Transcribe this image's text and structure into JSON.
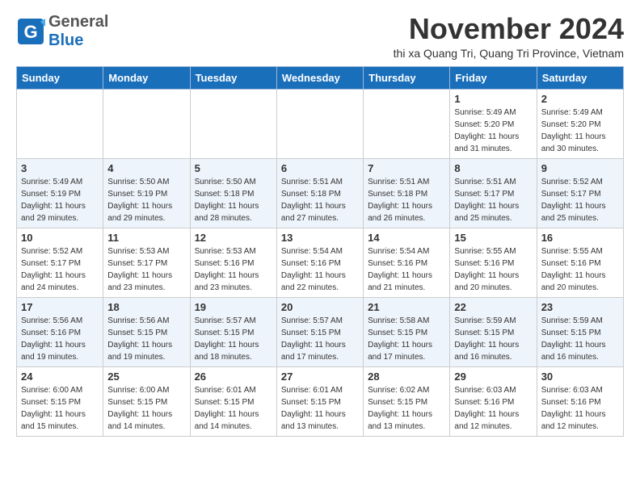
{
  "header": {
    "logo_general": "General",
    "logo_blue": "Blue",
    "month_title": "November 2024",
    "subtitle": "thi xa Quang Tri, Quang Tri Province, Vietnam"
  },
  "days_of_week": [
    "Sunday",
    "Monday",
    "Tuesday",
    "Wednesday",
    "Thursday",
    "Friday",
    "Saturday"
  ],
  "weeks": [
    [
      {
        "day": "",
        "info": ""
      },
      {
        "day": "",
        "info": ""
      },
      {
        "day": "",
        "info": ""
      },
      {
        "day": "",
        "info": ""
      },
      {
        "day": "",
        "info": ""
      },
      {
        "day": "1",
        "info": "Sunrise: 5:49 AM\nSunset: 5:20 PM\nDaylight: 11 hours\nand 31 minutes."
      },
      {
        "day": "2",
        "info": "Sunrise: 5:49 AM\nSunset: 5:20 PM\nDaylight: 11 hours\nand 30 minutes."
      }
    ],
    [
      {
        "day": "3",
        "info": "Sunrise: 5:49 AM\nSunset: 5:19 PM\nDaylight: 11 hours\nand 29 minutes."
      },
      {
        "day": "4",
        "info": "Sunrise: 5:50 AM\nSunset: 5:19 PM\nDaylight: 11 hours\nand 29 minutes."
      },
      {
        "day": "5",
        "info": "Sunrise: 5:50 AM\nSunset: 5:18 PM\nDaylight: 11 hours\nand 28 minutes."
      },
      {
        "day": "6",
        "info": "Sunrise: 5:51 AM\nSunset: 5:18 PM\nDaylight: 11 hours\nand 27 minutes."
      },
      {
        "day": "7",
        "info": "Sunrise: 5:51 AM\nSunset: 5:18 PM\nDaylight: 11 hours\nand 26 minutes."
      },
      {
        "day": "8",
        "info": "Sunrise: 5:51 AM\nSunset: 5:17 PM\nDaylight: 11 hours\nand 25 minutes."
      },
      {
        "day": "9",
        "info": "Sunrise: 5:52 AM\nSunset: 5:17 PM\nDaylight: 11 hours\nand 25 minutes."
      }
    ],
    [
      {
        "day": "10",
        "info": "Sunrise: 5:52 AM\nSunset: 5:17 PM\nDaylight: 11 hours\nand 24 minutes."
      },
      {
        "day": "11",
        "info": "Sunrise: 5:53 AM\nSunset: 5:17 PM\nDaylight: 11 hours\nand 23 minutes."
      },
      {
        "day": "12",
        "info": "Sunrise: 5:53 AM\nSunset: 5:16 PM\nDaylight: 11 hours\nand 23 minutes."
      },
      {
        "day": "13",
        "info": "Sunrise: 5:54 AM\nSunset: 5:16 PM\nDaylight: 11 hours\nand 22 minutes."
      },
      {
        "day": "14",
        "info": "Sunrise: 5:54 AM\nSunset: 5:16 PM\nDaylight: 11 hours\nand 21 minutes."
      },
      {
        "day": "15",
        "info": "Sunrise: 5:55 AM\nSunset: 5:16 PM\nDaylight: 11 hours\nand 20 minutes."
      },
      {
        "day": "16",
        "info": "Sunrise: 5:55 AM\nSunset: 5:16 PM\nDaylight: 11 hours\nand 20 minutes."
      }
    ],
    [
      {
        "day": "17",
        "info": "Sunrise: 5:56 AM\nSunset: 5:16 PM\nDaylight: 11 hours\nand 19 minutes."
      },
      {
        "day": "18",
        "info": "Sunrise: 5:56 AM\nSunset: 5:15 PM\nDaylight: 11 hours\nand 19 minutes."
      },
      {
        "day": "19",
        "info": "Sunrise: 5:57 AM\nSunset: 5:15 PM\nDaylight: 11 hours\nand 18 minutes."
      },
      {
        "day": "20",
        "info": "Sunrise: 5:57 AM\nSunset: 5:15 PM\nDaylight: 11 hours\nand 17 minutes."
      },
      {
        "day": "21",
        "info": "Sunrise: 5:58 AM\nSunset: 5:15 PM\nDaylight: 11 hours\nand 17 minutes."
      },
      {
        "day": "22",
        "info": "Sunrise: 5:59 AM\nSunset: 5:15 PM\nDaylight: 11 hours\nand 16 minutes."
      },
      {
        "day": "23",
        "info": "Sunrise: 5:59 AM\nSunset: 5:15 PM\nDaylight: 11 hours\nand 16 minutes."
      }
    ],
    [
      {
        "day": "24",
        "info": "Sunrise: 6:00 AM\nSunset: 5:15 PM\nDaylight: 11 hours\nand 15 minutes."
      },
      {
        "day": "25",
        "info": "Sunrise: 6:00 AM\nSunset: 5:15 PM\nDaylight: 11 hours\nand 14 minutes."
      },
      {
        "day": "26",
        "info": "Sunrise: 6:01 AM\nSunset: 5:15 PM\nDaylight: 11 hours\nand 14 minutes."
      },
      {
        "day": "27",
        "info": "Sunrise: 6:01 AM\nSunset: 5:15 PM\nDaylight: 11 hours\nand 13 minutes."
      },
      {
        "day": "28",
        "info": "Sunrise: 6:02 AM\nSunset: 5:15 PM\nDaylight: 11 hours\nand 13 minutes."
      },
      {
        "day": "29",
        "info": "Sunrise: 6:03 AM\nSunset: 5:16 PM\nDaylight: 11 hours\nand 12 minutes."
      },
      {
        "day": "30",
        "info": "Sunrise: 6:03 AM\nSunset: 5:16 PM\nDaylight: 11 hours\nand 12 minutes."
      }
    ]
  ]
}
